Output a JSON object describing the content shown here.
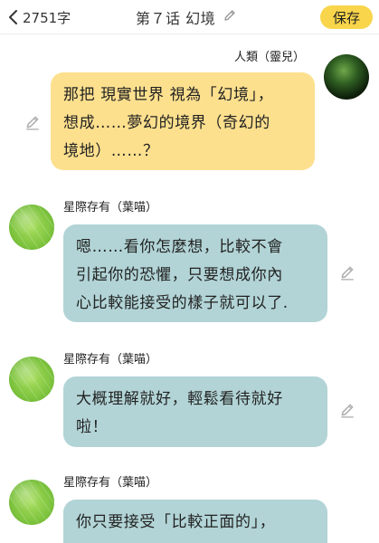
{
  "header": {
    "word_count": "2751字",
    "title": "第７话 幻境",
    "save_label": "保存"
  },
  "messages": [
    {
      "sender": "人類（靈兒）",
      "side": "right",
      "lines": [
        "那把 現實世界 視為「幻境」，",
        "想成……夢幻的境界（奇幻的",
        "境地）……？"
      ]
    },
    {
      "sender": "星際存有（葉喵）",
      "side": "left",
      "lines": [
        "嗯……看你怎麼想，比較不會",
        "引起你的恐懼，只要想成你內",
        "心比較能接受的樣子就可以了."
      ]
    },
    {
      "sender": "星際存有（葉喵）",
      "side": "left",
      "lines": [
        "大概理解就好，輕鬆看待就好",
        "啦！"
      ]
    },
    {
      "sender": "星際存有（葉喵）",
      "side": "left",
      "lines": [
        "你只要接受「比較正面的」，"
      ]
    }
  ],
  "colors": {
    "save_button": "#f8d54a",
    "user_bubble": "#fde08e",
    "bot_bubble": "#b2d4d6"
  },
  "icons": {
    "back": "chevron-left-icon",
    "title_edit": "pencil-icon",
    "message_edit": "pencil-icon"
  }
}
